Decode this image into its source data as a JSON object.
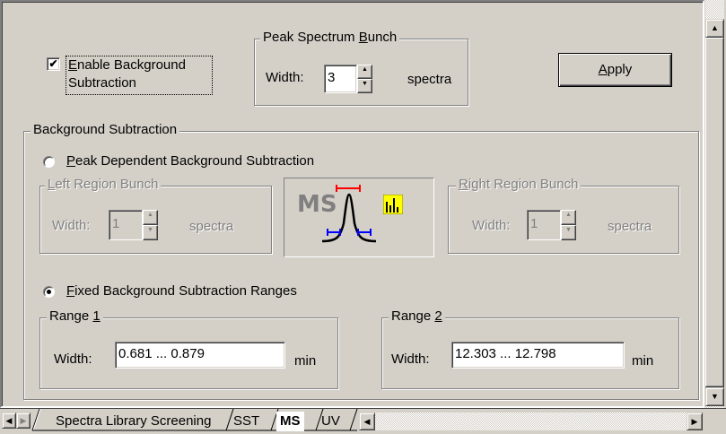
{
  "enable_background": {
    "checked": true,
    "check_mark": "✔",
    "label_line1_prefix": "E",
    "label_line1_rest": "nable Background",
    "label_line2": "Subtraction"
  },
  "peak_spectrum_bunch": {
    "title_prefix": "Peak Spectrum ",
    "title_accel": "B",
    "title_suffix": "unch",
    "width_label": "Width:",
    "width_value": "3",
    "unit": "spectra"
  },
  "apply_button": {
    "accel": "A",
    "rest": "pply"
  },
  "background_subtraction": {
    "title": "Background Subtraction",
    "peak_dependent": {
      "selected": false,
      "label_accel": "P",
      "label_rest": "eak Dependent Background Subtraction"
    },
    "left_region": {
      "title_accel": "L",
      "title_rest": "eft Region Bunch",
      "width_label": "Width:",
      "value": "1",
      "unit": "spectra"
    },
    "right_region": {
      "title_accel": "R",
      "title_rest": "ight Region Bunch",
      "width_label": "Width:",
      "value": "1",
      "unit": "spectra"
    },
    "illustration": {
      "ms_text": "MS"
    },
    "fixed_ranges": {
      "selected": true,
      "label_accel": "F",
      "label_rest": "ixed Background Subtraction Ranges"
    },
    "range1": {
      "title_prefix": "Range ",
      "title_accel": "1",
      "width_label": "Width:",
      "value": "0.681 ... 0.879",
      "unit": "min"
    },
    "range2": {
      "title_prefix": "Range ",
      "title_accel": "2",
      "width_label": "Width:",
      "value": "12.303 ... 12.798",
      "unit": "min"
    }
  },
  "tabs": [
    {
      "label": "Spectra Library Screening",
      "active": false
    },
    {
      "label": "SST",
      "active": false
    },
    {
      "label": "MS",
      "active": true
    },
    {
      "label": "UV",
      "active": false
    }
  ],
  "scroll_glyphs": {
    "up": "▲",
    "down": "▼",
    "left": "◀",
    "right": "▶"
  },
  "colors": {
    "face": "#d4d0c8",
    "shadow": "#808080",
    "highlight": "#ffffff",
    "accent_red": "#ff0000",
    "accent_blue": "#0000ff",
    "icon_yellow": "#ffff00"
  }
}
